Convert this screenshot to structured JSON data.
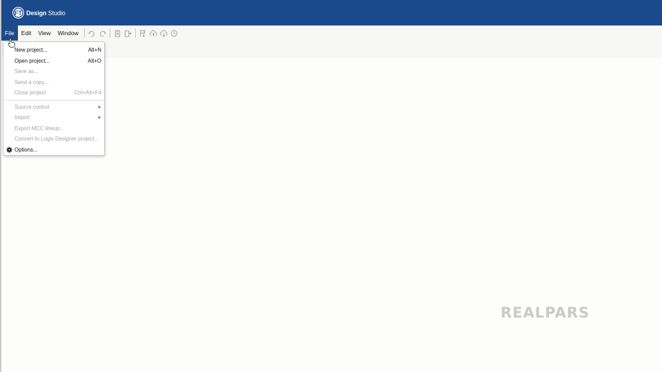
{
  "app": {
    "brand_badge": "FT",
    "brand_bold": "Design",
    "brand_rest": " Studio"
  },
  "menubar": {
    "items": [
      {
        "label": "File",
        "active": true
      },
      {
        "label": "Edit"
      },
      {
        "label": "View"
      },
      {
        "label": "Window"
      }
    ],
    "tools": [
      "undo-icon",
      "redo-icon",
      "clipboard-icon",
      "paste-icon",
      "flag-download-icon",
      "cloud-upload-icon",
      "cloud-download-icon",
      "history-icon"
    ]
  },
  "file_menu": {
    "items": [
      {
        "label": "New project...",
        "shortcut": "Alt+N",
        "enabled": true
      },
      {
        "label": "Open project...",
        "shortcut": "Alt+O",
        "enabled": true
      },
      {
        "label": "Save as...",
        "shortcut": "",
        "enabled": false
      },
      {
        "label": "Send a copy...",
        "shortcut": "",
        "enabled": false
      },
      {
        "label": "Close project",
        "shortcut": "Ctrl+Alt+F4",
        "enabled": false
      },
      {
        "label": "Source control",
        "submenu": true,
        "enabled": false
      },
      {
        "label": "Import",
        "submenu": true,
        "enabled": false
      },
      {
        "label": "Export MCC lineup...",
        "enabled": false
      },
      {
        "label": "Convert to Logix Designer project...",
        "enabled": false
      },
      {
        "label": "Options...",
        "icon": "gear-icon",
        "enabled": true
      }
    ]
  },
  "watermark": {
    "text": "REALPARS"
  },
  "colors": {
    "titlebar": "#1b4a8c",
    "menu_active": "#1b4a8c",
    "disabled_text": "#a3a3a3"
  }
}
